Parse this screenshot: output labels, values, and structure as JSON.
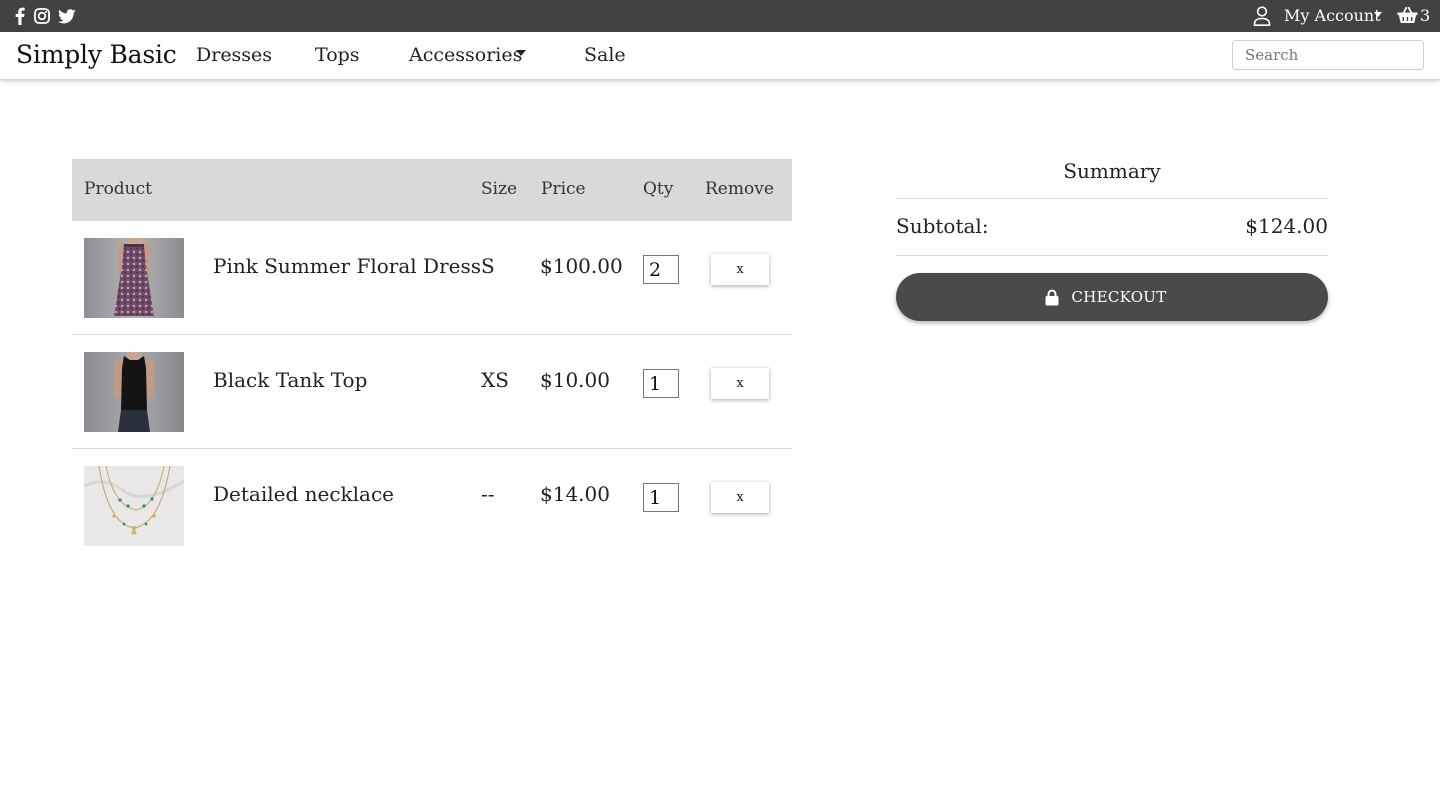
{
  "topbar": {
    "social_icons": [
      "facebook-icon",
      "instagram-icon",
      "twitter-icon"
    ],
    "account_label": "My Account",
    "cart_count": "3"
  },
  "nav": {
    "brand": "Simply Basic",
    "links": [
      "Dresses",
      "Tops",
      "Accessories",
      "Sale"
    ],
    "search_placeholder": "Search"
  },
  "cart": {
    "headers": {
      "product": "Product",
      "size": "Size",
      "price": "Price",
      "qty": "Qty",
      "remove": "Remove"
    },
    "items": [
      {
        "name": "Pink Summer Floral Dress",
        "size": "S",
        "price": "$100.00",
        "qty": "2",
        "remove_label": "x"
      },
      {
        "name": "Black Tank Top",
        "size": "XS",
        "price": "$10.00",
        "qty": "1",
        "remove_label": "x"
      },
      {
        "name": "Detailed necklace",
        "size": "--",
        "price": "$14.00",
        "qty": "1",
        "remove_label": "x"
      }
    ]
  },
  "summary": {
    "title": "Summary",
    "subtotal_label": "Subtotal:",
    "subtotal_value": "$124.00",
    "checkout_label": "CHECKOUT"
  },
  "colors": {
    "topbar_bg": "#424242",
    "table_header_bg": "#d9d9d9",
    "checkout_bg": "#4a4a4a"
  }
}
